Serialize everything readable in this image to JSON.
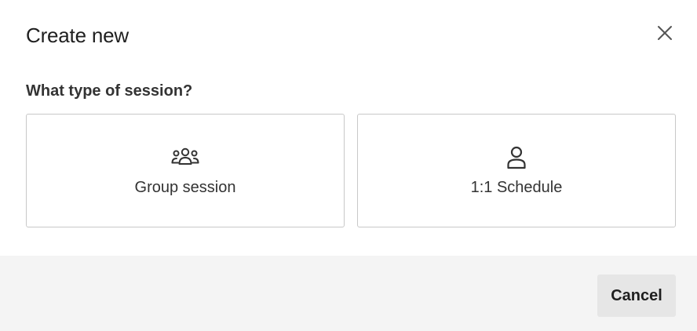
{
  "dialog": {
    "title": "Create new",
    "close_icon": "close-icon",
    "question": "What type of session?",
    "options": [
      {
        "label": "Group session",
        "icon": "group-users-icon"
      },
      {
        "label": "1:1 Schedule",
        "icon": "single-user-icon"
      }
    ]
  },
  "footer": {
    "cancel_label": "Cancel"
  },
  "colors": {
    "footer_background": "#f4f4f4",
    "cancel_background": "#e6e6e6",
    "card_border": "#c8c8c8"
  }
}
